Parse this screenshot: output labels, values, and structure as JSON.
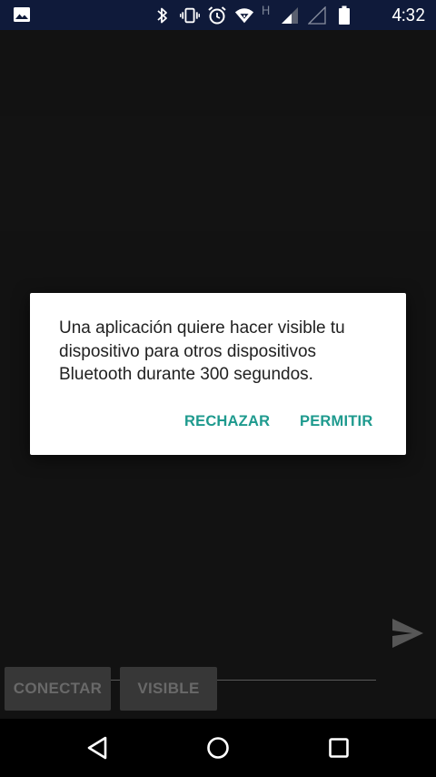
{
  "status_bar": {
    "time": "4:32",
    "network_type": "H",
    "icons": [
      "image-icon",
      "bluetooth-icon",
      "vibrate-icon",
      "alarm-icon",
      "wifi-icon",
      "signal-icon",
      "signal-empty-icon",
      "battery-icon"
    ]
  },
  "dialog": {
    "message": "Una aplicación quiere hacer visible tu dispositivo para otros dispositivos Bluetooth durante 300 segundos.",
    "deny_label": "RECHAZAR",
    "allow_label": "PERMITIR",
    "accent_color": "#1e9a8e"
  },
  "app": {
    "message_input_value": "",
    "connect_label": "CONECTAR",
    "visible_label": "VISIBLE"
  },
  "nav_bar": {
    "buttons": [
      "back-icon",
      "home-icon",
      "recents-icon"
    ]
  }
}
